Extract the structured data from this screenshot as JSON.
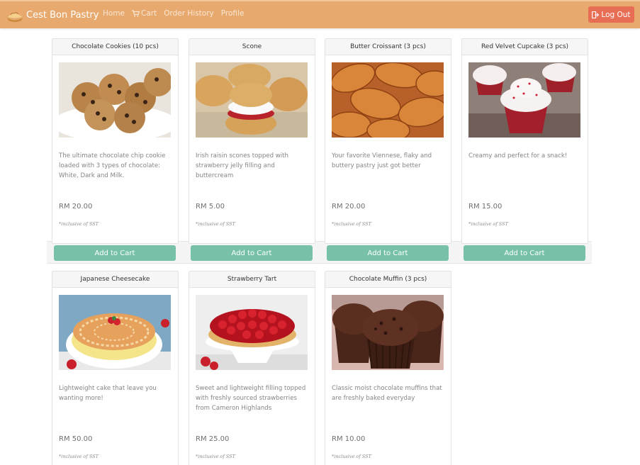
{
  "nav": {
    "brand": "Cest Bon Pastry",
    "home": "Home",
    "cart": "Cart",
    "order_history": "Order History",
    "profile": "Profile",
    "logout": "Log Out"
  },
  "colors": {
    "navbar": "#e8a96e",
    "logout_button": "#e76e55",
    "add_to_cart_button": "#76c1a7"
  },
  "products": [
    {
      "name": "Chocolate Cookies (10 pcs)",
      "description": "The ultimate chocolate chip cookie loaded with 3 types of chocolate: White, Dark and Milk.",
      "price": "RM 20.00",
      "note": "*inclusive of SST",
      "button": "Add to Cart"
    },
    {
      "name": "Scone",
      "description": "Irish raisin scones topped with strawberry jelly filling and buttercream",
      "price": "RM 5.00",
      "note": "*inclusive of SST",
      "button": "Add to Cart"
    },
    {
      "name": "Butter Croissant (3 pcs)",
      "description": "Your favorite Viennese, flaky and buttery pastry just got better",
      "price": "RM 20.00",
      "note": "*inclusive of SST",
      "button": "Add to Cart"
    },
    {
      "name": "Red Velvet Cupcake (3 pcs)",
      "description": "Creamy and perfect for a snack!",
      "price": "RM 15.00",
      "note": "*inclusive of SST",
      "button": "Add to Cart"
    },
    {
      "name": "Japanese Cheesecake",
      "description": "Lightweight cake that leave you wanting more!",
      "price": "RM 50.00",
      "note": "*inclusive of SST"
    },
    {
      "name": "Strawberry Tart",
      "description": "Sweet and lightweight filling topped with freshly sourced strawberries from Cameron Highlands",
      "price": "RM 25.00",
      "note": "*inclusive of SST"
    },
    {
      "name": "Chocolate Muffin (3 pcs)",
      "description": "Classic moist chocolate muffins that are freshly baked everyday",
      "price": "RM 10.00",
      "note": "*inclusive of SST"
    }
  ]
}
